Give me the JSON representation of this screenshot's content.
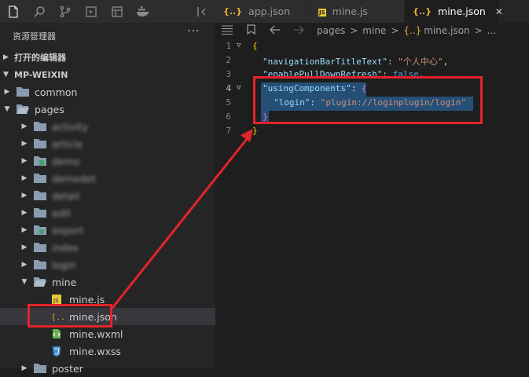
{
  "sidebar": {
    "title": "资源管理器",
    "more": "···",
    "section_open_editors": "打开的编辑器",
    "section_project": "MP-WEIXIN",
    "tree": [
      {
        "label": "common",
        "type": "folder",
        "indent": 0,
        "twisty": "closed"
      },
      {
        "label": "pages",
        "type": "folder-open",
        "indent": 0,
        "twisty": "open"
      },
      {
        "label": "activity",
        "type": "folder",
        "indent": 1,
        "twisty": "closed",
        "blurred": true
      },
      {
        "label": "article",
        "type": "folder",
        "indent": 1,
        "twisty": "closed",
        "blurred": true
      },
      {
        "label": "demo",
        "type": "folder-special",
        "indent": 1,
        "twisty": "closed",
        "blurred": true
      },
      {
        "label": "demodet",
        "type": "folder",
        "indent": 1,
        "twisty": "closed",
        "blurred": true
      },
      {
        "label": "detail",
        "type": "folder",
        "indent": 1,
        "twisty": "closed",
        "blurred": true
      },
      {
        "label": "edit",
        "type": "folder",
        "indent": 1,
        "twisty": "closed",
        "blurred": true
      },
      {
        "label": "export",
        "type": "folder-special",
        "indent": 1,
        "twisty": "closed",
        "blurred": true
      },
      {
        "label": "index",
        "type": "folder",
        "indent": 1,
        "twisty": "closed",
        "blurred": true
      },
      {
        "label": "login",
        "type": "folder",
        "indent": 1,
        "twisty": "closed",
        "blurred": true
      },
      {
        "label": "mine",
        "type": "folder-open",
        "indent": 1,
        "twisty": "open"
      },
      {
        "label": "mine.js",
        "type": "file-js",
        "indent": 2
      },
      {
        "label": "mine.json",
        "type": "file-json",
        "indent": 2,
        "selected": true
      },
      {
        "label": "mine.wxml",
        "type": "file-wxml",
        "indent": 2
      },
      {
        "label": "mine.wxss",
        "type": "file-wxss",
        "indent": 2
      },
      {
        "label": "poster",
        "type": "folder",
        "indent": 1,
        "twisty": "closed"
      }
    ]
  },
  "tabs": [
    {
      "label": "app.json",
      "icon": "{..}",
      "active": false
    },
    {
      "label": "mine.js",
      "icon": "JS",
      "active": false
    },
    {
      "label": "mine.json",
      "icon": "{..}",
      "active": true,
      "close": "✕"
    }
  ],
  "breadcrumb": [
    "pages",
    ">",
    "mine",
    ">",
    "{..}",
    "mine.json",
    ">",
    "..."
  ],
  "editor": {
    "line_numbers": [
      "1",
      "2",
      "3",
      "4",
      "5",
      "6",
      "7"
    ],
    "current_line": "4"
  },
  "code": {
    "l1_brace": "{",
    "l2_key": "\"navigationBarTitleText\"",
    "l2_colon": ": ",
    "l2_val": "\"个人中心\"",
    "l2_comma": ",",
    "l3_key": "\"enablePullDownRefresh\"",
    "l3_colon": ": ",
    "l3_val": "false",
    "l3_comma": ",",
    "l4_key": "\"usingComponents\"",
    "l4_colon": ": ",
    "l4_brace": "{",
    "l5_key": "\"login\"",
    "l5_colon": ": ",
    "l5_val": "\"plugin://loginplugin/login\"",
    "l6_brace": "}",
    "l7_brace": "}"
  },
  "colors": {
    "annotation_red": "#e4232c",
    "selection": "#264f78"
  }
}
